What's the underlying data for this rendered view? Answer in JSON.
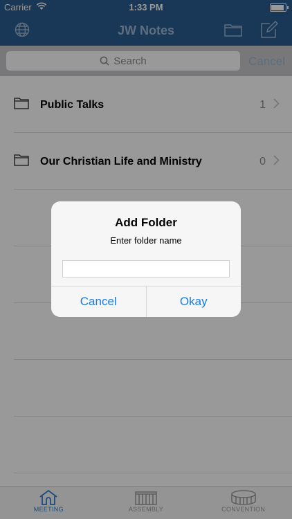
{
  "status_bar": {
    "carrier": "Carrier",
    "time": "1:33 PM",
    "battery_level": 1.0
  },
  "nav": {
    "title": "JW Notes",
    "icons": [
      "globe-icon",
      "folder-icon",
      "compose-icon"
    ]
  },
  "search": {
    "placeholder": "Search",
    "cancel_label": "Cancel"
  },
  "folders": [
    {
      "label": "Public Talks",
      "count": "1"
    },
    {
      "label": "Our Christian Life and Ministry",
      "count": "0"
    }
  ],
  "tabs": [
    {
      "label": "MEETING",
      "icon": "house-icon",
      "active": true
    },
    {
      "label": "ASSEMBLY",
      "icon": "assembly-hall-icon",
      "active": false
    },
    {
      "label": "CONVENTION",
      "icon": "stadium-icon",
      "active": false
    }
  ],
  "dialog": {
    "title": "Add Folder",
    "message": "Enter folder name",
    "input_value": "",
    "cancel_label": "Cancel",
    "ok_label": "Okay"
  },
  "colors": {
    "nav_bg": "#2a5d8f",
    "accent": "#1a7be0",
    "active_tab": "#2a7fd1"
  }
}
